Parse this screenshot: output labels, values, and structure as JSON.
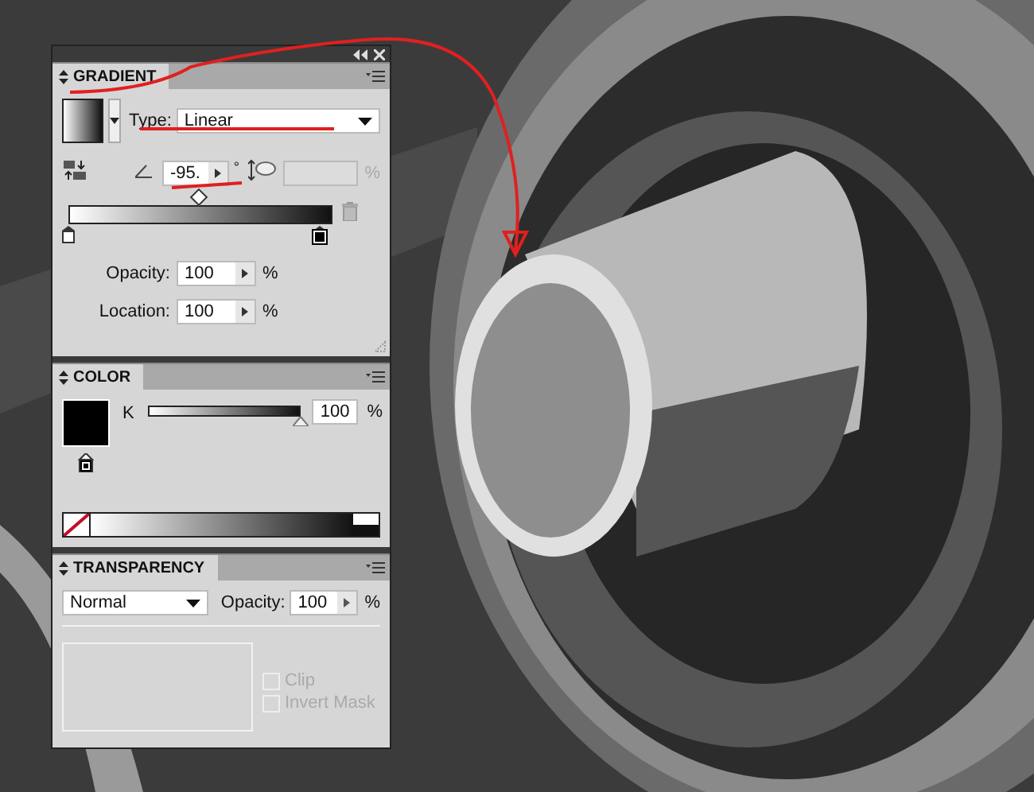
{
  "gradient": {
    "title": "GRADIENT",
    "type_label": "Type:",
    "type_value": "Linear",
    "angle_value": "-95.",
    "angle_unit": "°",
    "aspect_unit": "%",
    "midpoint": {
      "level": 0.5
    },
    "stops": [
      {
        "color": "#ffffff",
        "selected": false
      },
      {
        "color": "#000000",
        "selected": true
      }
    ],
    "opacity_label": "Opacity:",
    "opacity_value": "100",
    "opacity_unit": "%",
    "location_label": "Location:",
    "location_value": "100",
    "location_unit": "%"
  },
  "color": {
    "title": "COLOR",
    "channel_label": "K",
    "level": 1,
    "value": "100",
    "unit": "%"
  },
  "transparency": {
    "title": "TRANSPARENCY",
    "blend_mode": "Normal",
    "opacity_label": "Opacity:",
    "opacity_value": "100",
    "unit": "%",
    "options": [
      {
        "label": "Clip",
        "checked": false,
        "disabled": true
      },
      {
        "label": "Invert Mask",
        "checked": false,
        "disabled": true
      }
    ]
  }
}
